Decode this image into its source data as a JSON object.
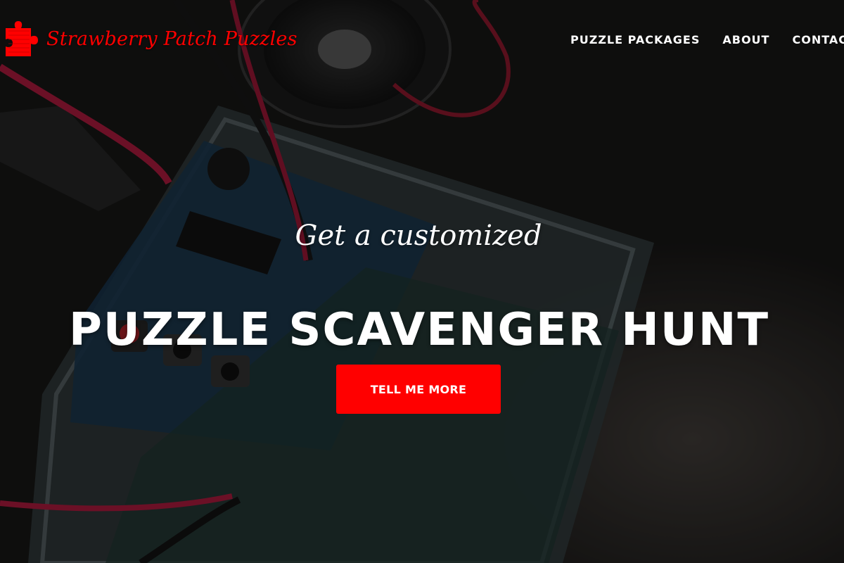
{
  "brand": {
    "name": "Strawberry Patch Puzzles",
    "icon": "puzzle-piece-icon",
    "color": "#ff0000"
  },
  "nav": {
    "items": [
      {
        "label": "PUZZLE PACKAGES"
      },
      {
        "label": "ABOUT"
      },
      {
        "label": "CONTACT"
      }
    ]
  },
  "hero": {
    "lead_in": "Get a customized",
    "heading": "PUZZLE SCAVENGER HUNT",
    "cta_label": "TELL ME MORE",
    "background": "photo-of-arduino-board-with-speaker-and-wires"
  },
  "colors": {
    "accent": "#ff0000",
    "text": "#ffffff"
  }
}
